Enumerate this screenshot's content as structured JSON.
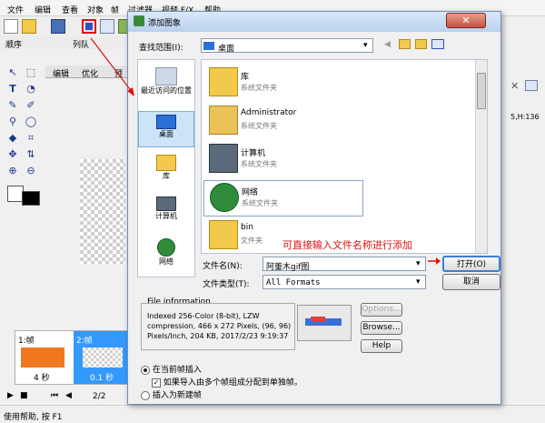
{
  "menu": [
    "文件",
    "编辑",
    "查看",
    "对象",
    "帧",
    "过滤器",
    "视频 F/X",
    "帮助"
  ],
  "left_panel": {
    "seq_label": "顺序",
    "list_label": "列队",
    "tabs": [
      "编辑",
      "优化",
      "预"
    ]
  },
  "frames": {
    "frame1_label": "1:帧",
    "frame1_time": "4 秒",
    "frame2_label": "2:帧",
    "frame2_time": "0.1 秒",
    "counter": "2/2"
  },
  "status_text": "使用帮助, 按 F1",
  "right_coord": "5,H:136",
  "dialog": {
    "title": "添加图象",
    "lookin_label": "查找范围(I):",
    "lookin_value": "桌面",
    "places": [
      {
        "label": "最近访问的位置",
        "icon": "recent-places-icon"
      },
      {
        "label": "桌面",
        "icon": "desktop-icon"
      },
      {
        "label": "库",
        "icon": "library-icon"
      },
      {
        "label": "计算机",
        "icon": "computer-icon"
      },
      {
        "label": "网络",
        "icon": "network-icon"
      }
    ],
    "files": [
      {
        "name": "库",
        "type": "系统文件夹",
        "icon": "library-icon"
      },
      {
        "name": "Administrator",
        "type": "系统文件夹",
        "icon": "user-folder-icon"
      },
      {
        "name": "计算机",
        "type": "系统文件夹",
        "icon": "computer-icon"
      },
      {
        "name": "网络",
        "type": "系统文件夹",
        "icon": "network-icon"
      },
      {
        "name": "bin",
        "type": "文件夹",
        "icon": "folder-icon"
      }
    ],
    "filename_label": "文件名(N):",
    "filename_value": "阿董木gif图",
    "filetype_label": "文件类型(T):",
    "filetype_value": "All Formats",
    "open_button": "打开(O)",
    "cancel_button": "取消",
    "fileinfo_title": "File information",
    "fileinfo_lines": [
      "Indexed 256-Color (8-bit), LZW",
      "compression, 466 x 272 Pixels, (96, 96)",
      "Pixels/Inch, 204 KB, 2017/2/23 9:19:37"
    ],
    "options_button": "Options...",
    "browse_button": "Browse...",
    "help_button": "Help",
    "radio_insert_current": "在当前帧插入",
    "checkbox_split_frames": "如果导入由多个帧组成分配到单独帧。",
    "radio_insert_new": "插入为新建帧"
  },
  "annotation": "可直接输入文件名称进行添加",
  "colors": {
    "annotation_red": "#e01010",
    "selection_blue": "#3399ff",
    "frame_orange": "#f07820"
  }
}
